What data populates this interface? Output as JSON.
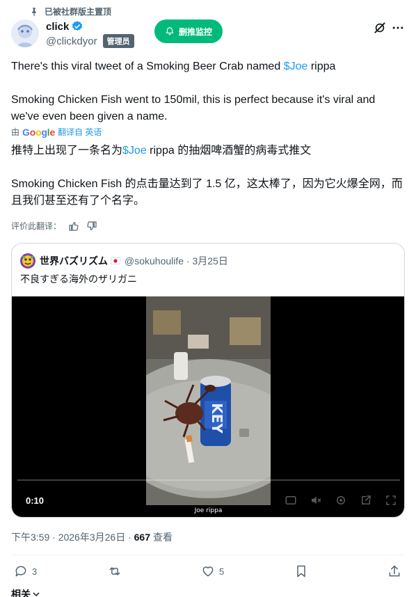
{
  "pinned": {
    "label": "已被社群版主置顶",
    "icon": "pin-icon"
  },
  "author": {
    "display_name": "click",
    "handle": "@clickdyor",
    "badge": "管理员",
    "verified_icon": "verified-badge-icon"
  },
  "follow_button": {
    "label": "删推监控",
    "icon": "bell-icon",
    "color": "#00ba7c"
  },
  "top_actions": {
    "grok_icon": "grok-icon",
    "more_icon": "more-icon"
  },
  "tweet": {
    "line1_pre": "There's this viral tweet of a Smoking Beer Crab named ",
    "line1_cashtag": "$Joe",
    "line1_post": " rippa",
    "paragraph2": "Smoking Chicken Fish went to 150mil, this is perfect because it's viral and we've even been given a name."
  },
  "translation": {
    "by": "由",
    "google": [
      "G",
      "o",
      "o",
      "g",
      "l",
      "e"
    ],
    "label": "翻译自 英语",
    "line1_pre": "推特上出现了一条名为",
    "line1_cashtag": "$Joe",
    "line1_post": " rippa 的抽烟啤酒蟹的病毒式推文",
    "paragraph2": "Smoking Chicken Fish 的点击量达到了 1.5 亿，这太棒了，因为它火爆全网，而且我们甚至还有了个名字。"
  },
  "rate": {
    "label": "评价此翻译：",
    "up_icon": "thumbs-up-icon",
    "down_icon": "thumbs-down-icon"
  },
  "quote": {
    "name": "世界バズリズム",
    "handle_date": "@sokuhoulife · 3月25日",
    "text": "不良すぎる海外のザリガニ",
    "flag_icon": "japan-flag-icon"
  },
  "video": {
    "time": "0:10",
    "caption": "Joe rippa"
  },
  "post_meta": {
    "timestamp": "下午3:59 · 2026年3月26日 · ",
    "views": "667",
    "views_label": " 查看"
  },
  "actions": {
    "replies": "3",
    "likes": "5"
  },
  "related": {
    "label": "相关"
  }
}
